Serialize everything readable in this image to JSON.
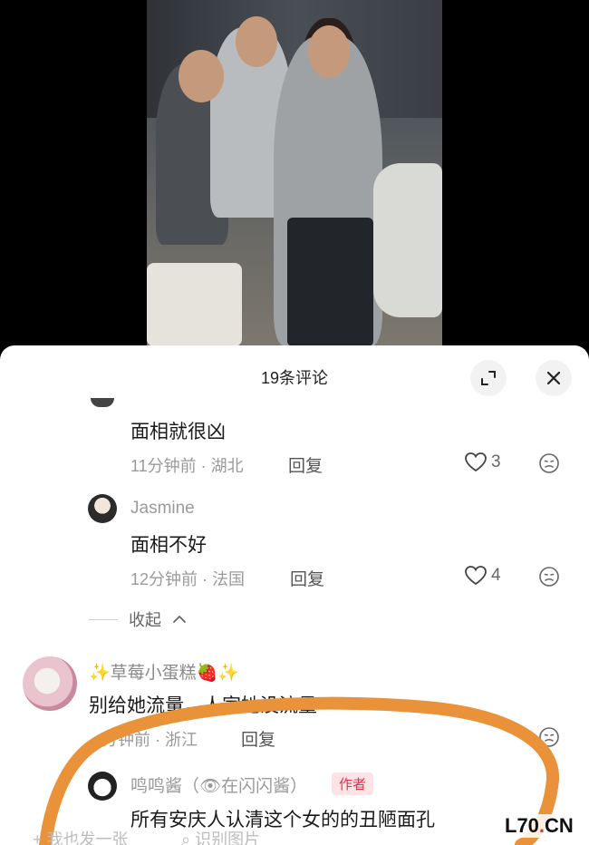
{
  "sheet": {
    "title": "19条评论"
  },
  "comments": [
    {
      "text": "面相就很凶",
      "time": "11分钟前 · 湖北",
      "reply": "回复",
      "likes": "3"
    },
    {
      "user": "Jasmine",
      "text": "面相不好",
      "time": "12分钟前 · 法国",
      "reply": "回复",
      "likes": "4"
    },
    {
      "user": "✨草莓小蛋糕🍓✨",
      "text": "别给她流量，人家她没流量",
      "time": "分钟前 · 浙江",
      "reply": "回复"
    },
    {
      "user": "鸣鸣酱（👁在闪闪酱）",
      "tag": "作者",
      "text": "所有安庆人认清这个女的的丑陋面孔"
    }
  ],
  "collapse_label": "收起",
  "bottom_bar": {
    "post": "我也发一张",
    "recognize": "识别图片"
  },
  "watermark": {
    "left": "L70",
    "dot": ".",
    "right": "CN"
  },
  "colors": {
    "annotation": "#e9923a",
    "author_tag": "#e3304a"
  }
}
